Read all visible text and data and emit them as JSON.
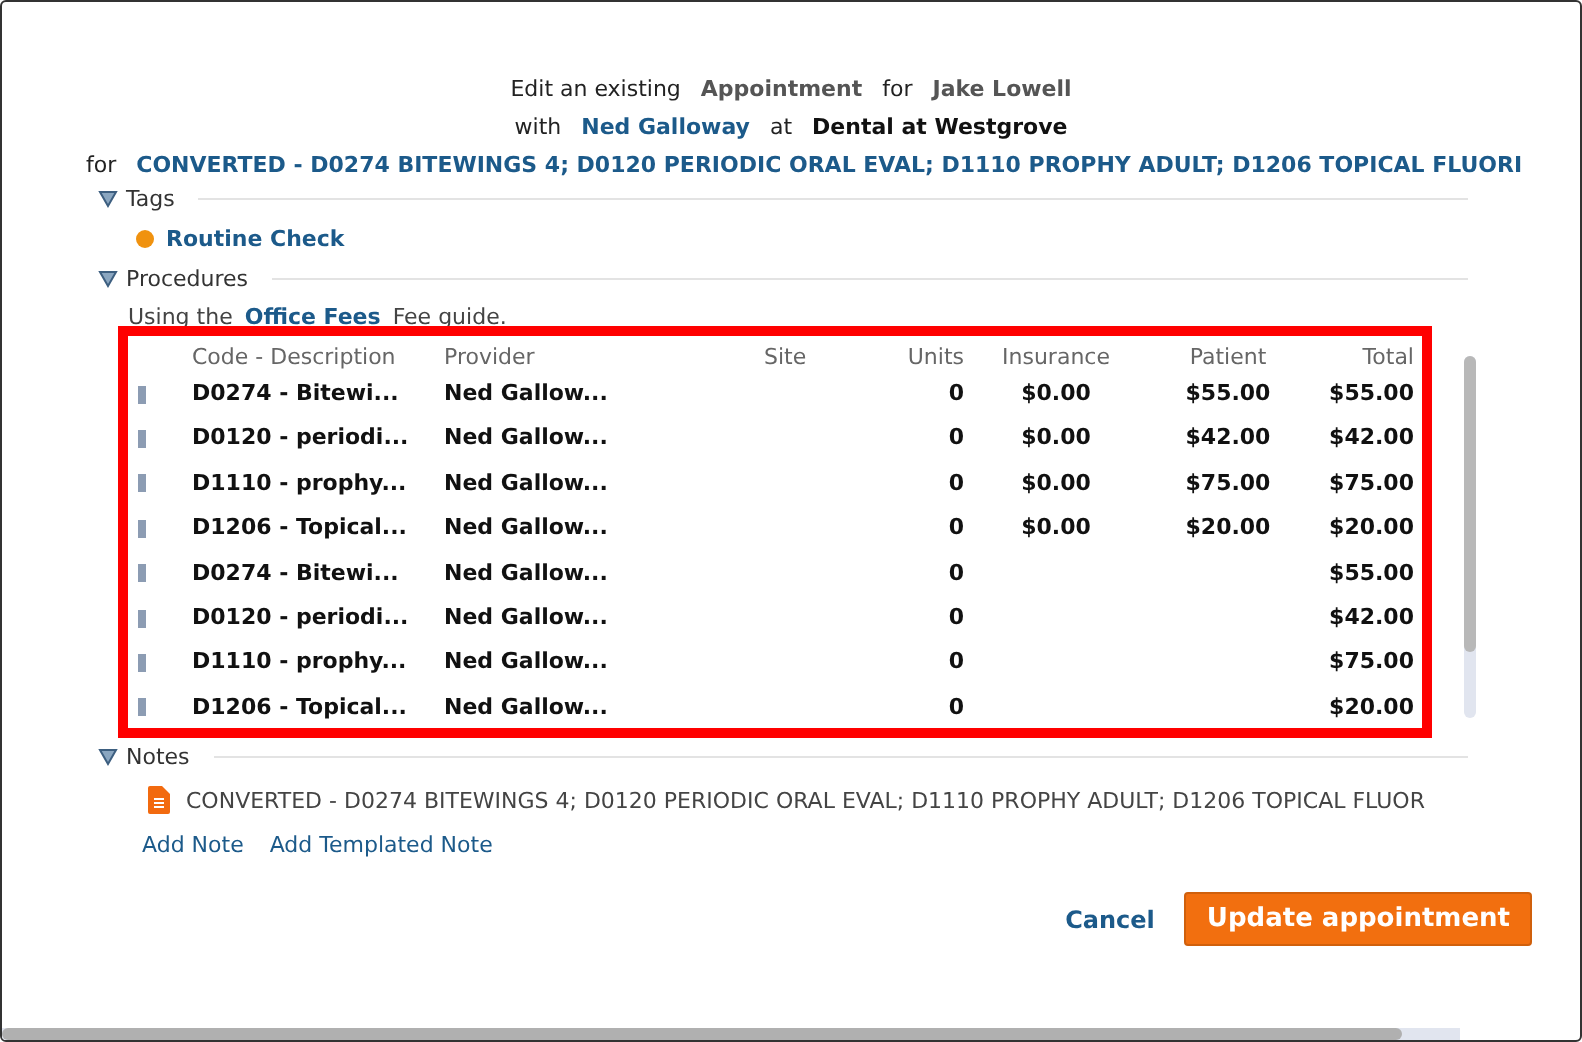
{
  "header": {
    "line1": [
      {
        "kind": "plain",
        "text": "Edit an existing"
      },
      {
        "kind": "strong",
        "text": "Appointment"
      },
      {
        "kind": "plain",
        "text": "for"
      },
      {
        "kind": "strong",
        "text": "Jake Lowell"
      }
    ],
    "line2": [
      {
        "kind": "plain",
        "text": "with"
      },
      {
        "kind": "link",
        "text": "Ned Galloway"
      },
      {
        "kind": "plain",
        "text": "at"
      },
      {
        "kind": "dark",
        "text": "Dental at Westgrove"
      }
    ],
    "line3": [
      {
        "kind": "plain",
        "text": "for"
      },
      {
        "kind": "link",
        "text": "CONVERTED - D0274 BITEWINGS 4; D0120 PERIODIC ORAL EVAL; D1110 PROPHY ADULT; D1206 TOPICAL FLUORI"
      }
    ]
  },
  "tags": {
    "title": "Tags",
    "expanded": true,
    "items": [
      {
        "label": "Routine Check",
        "color": "#f0920f"
      }
    ]
  },
  "procedures": {
    "title": "Procedures",
    "expanded": true,
    "fee_guide": {
      "before": "Using the",
      "link": "Office Fees",
      "after": "Fee guide."
    },
    "table": {
      "columns": [
        "Code - Description",
        "Provider",
        "Site",
        "Units",
        "Insurance",
        "Patient",
        "Total"
      ],
      "rows": [
        {
          "code": "D0274 - Bitewi...",
          "provider": "Ned Gallow...",
          "units": "0",
          "insurance": "$0.00",
          "patient": "$55.00",
          "total": "$55.00"
        },
        {
          "code": "D0120 - periodi...",
          "provider": "Ned Gallow...",
          "units": "0",
          "insurance": "$0.00",
          "patient": "$42.00",
          "total": "$42.00"
        },
        {
          "code": "D1110 - prophy...",
          "provider": "Ned Gallow...",
          "units": "0",
          "insurance": "$0.00",
          "patient": "$75.00",
          "total": "$75.00"
        },
        {
          "code": "D1206 - Topical...",
          "provider": "Ned Gallow...",
          "units": "0",
          "insurance": "$0.00",
          "patient": "$20.00",
          "total": "$20.00"
        },
        {
          "code": "D0274 - Bitewi...",
          "provider": "Ned Gallow...",
          "units": "0",
          "total": "$55.00"
        },
        {
          "code": "D0120 - periodi...",
          "provider": "Ned Gallow...",
          "units": "0",
          "total": "$42.00"
        },
        {
          "code": "D1110 - prophy...",
          "provider": "Ned Gallow...",
          "units": "0",
          "total": "$75.00"
        },
        {
          "code": "D1206 - Topical...",
          "provider": "Ned Gallow...",
          "units": "0",
          "total": "$20.00"
        }
      ]
    }
  },
  "notes": {
    "title": "Notes",
    "expanded": true,
    "items": [
      "CONVERTED - D0274 BITEWINGS 4; D0120 PERIODIC ORAL EVAL; D1110 PROPHY ADULT; D1206 TOPICAL FLUOR"
    ],
    "links": [
      "Add Note",
      "Add Templated Note"
    ]
  },
  "buttons": {
    "cancel": "Cancel",
    "submit": "Update appointment"
  }
}
